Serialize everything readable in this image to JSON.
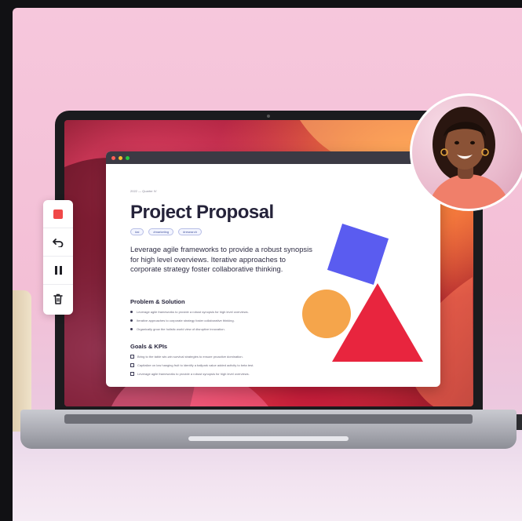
{
  "doc": {
    "meta": "2022 — Quarter IV",
    "title": "Project Proposal",
    "tags": [
      "#ai",
      "#marketing",
      "#research"
    ],
    "intro": "Leverage agile frameworks to provide a robust synopsis for high level overviews. Iterative approaches to corporate strategy foster collaborative thinking.",
    "section1": {
      "heading": "Problem & Solution",
      "items": [
        "Leverage agile frameworks to provide a robust synopsis for high level overviews.",
        "Iterative approaches to corporate strategy foster collaborative thinking.",
        "Organically grow the holistic world view of disruptive innovation."
      ]
    },
    "section2": {
      "heading": "Goals & KPIs",
      "items": [
        "Bring to the table win-win survival strategies to ensure proactive domination.",
        "Capitalize on low hanging fruit to identify a ballpark value added activity to beta test.",
        "Leverage agile frameworks to provide a robust synopsis for high level overviews."
      ]
    }
  },
  "colors": {
    "square": "#5a5cf0",
    "circle": "#f5a54b",
    "triangle": "#e8253e",
    "record": "#f04848"
  }
}
